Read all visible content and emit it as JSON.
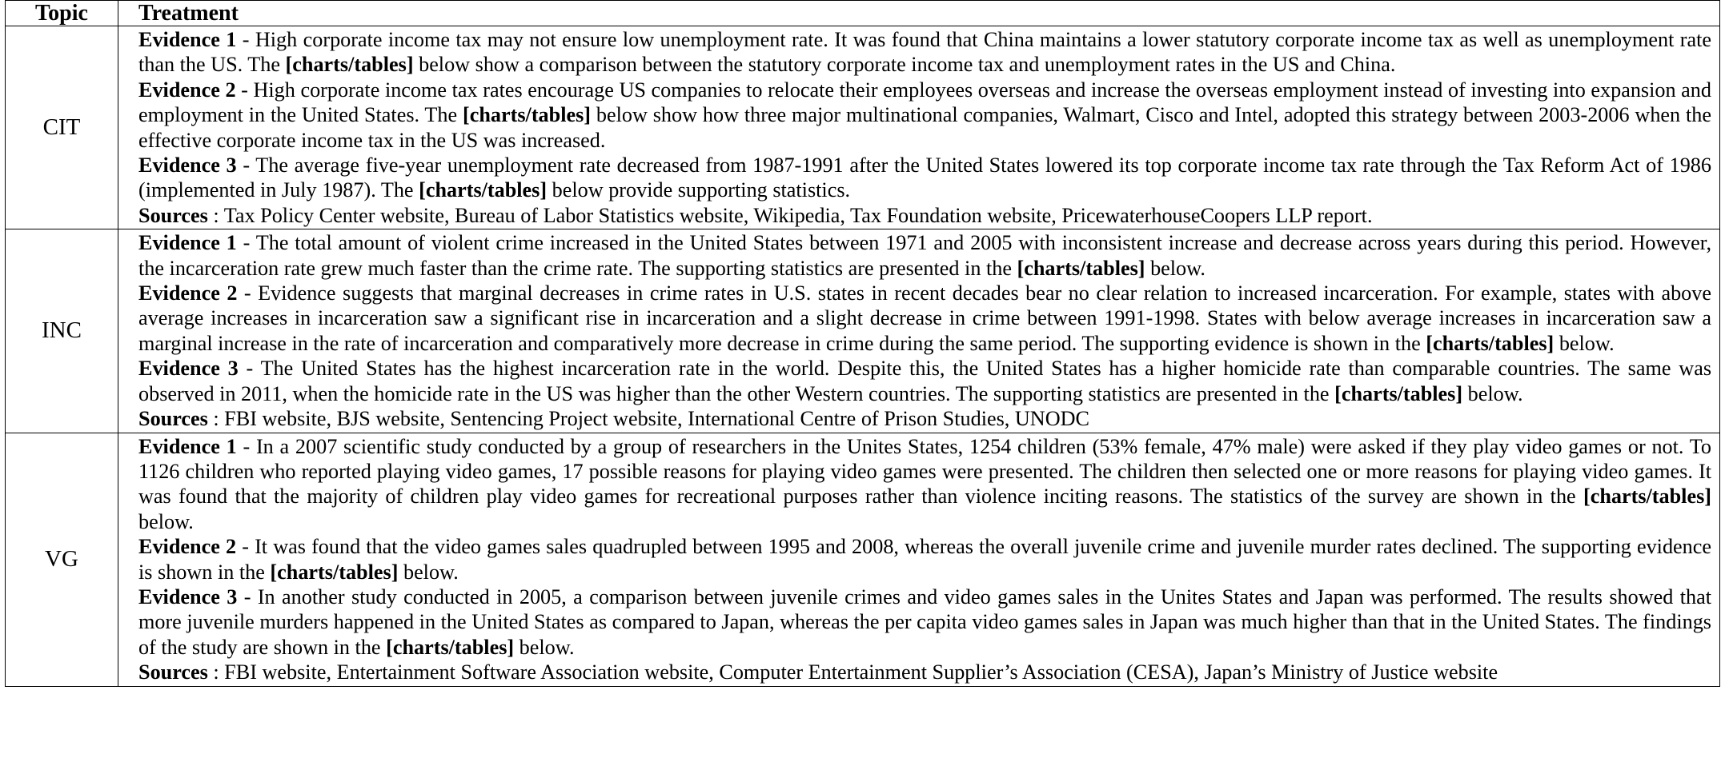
{
  "headers": {
    "topic": "Topic",
    "treatment": "Treatment"
  },
  "rows": [
    {
      "topic": "CIT",
      "evidence": [
        {
          "label": "Evidence 1",
          "pre": " - High corporate income tax may not ensure low unemployment rate.  It was found that China maintains a lower statutory corporate income tax as well as unemployment rate than the US. The ",
          "bold": "[charts/tables]",
          "post": " below show a comparison between the statutory corporate income tax and unemployment rates in the US and China."
        },
        {
          "label": "Evidence 2",
          "pre": " - High corporate income tax rates encourage US companies to relocate their employees overseas and increase the overseas employment instead of investing into expansion and employment in the United States. The ",
          "bold": "[charts/tables]",
          "post": " below show how three major multinational companies, Walmart, Cisco and Intel, adopted this strategy between 2003-2006 when the effective corporate income tax in the US was increased."
        },
        {
          "label": "Evidence 3",
          "pre": " - The average five-year unemployment rate decreased from 1987-1991 after the United States lowered its top corporate income tax rate through the Tax Reform Act of 1986 (implemented in July 1987). The ",
          "bold": "[charts/tables]",
          "post": " below provide supporting statistics."
        }
      ],
      "sources_label": "Sources",
      "sources": " : Tax Policy Center website, Bureau of Labor Statistics website, Wikipedia, Tax Foundation website, PricewaterhouseCoopers LLP report."
    },
    {
      "topic": "INC",
      "evidence": [
        {
          "label": "Evidence 1",
          "pre": " - The total amount of violent crime increased in the United States between 1971 and 2005 with inconsistent increase and decrease across years during this period. However, the incarceration rate grew much faster than the crime rate. The supporting statistics are presented in the ",
          "bold": "[charts/tables]",
          "post": " below."
        },
        {
          "label": "Evidence 2",
          "pre": " - Evidence suggests that marginal decreases in crime rates in U.S. states in recent decades bear no clear relation to increased incarceration. For example, states with above average increases in incarceration saw a significant rise in incarceration and a slight decrease in crime between 1991-1998. States with below average increases in incarceration saw a marginal increase in the rate of incarceration and comparatively more decrease in crime during the same period. The supporting evidence is shown in the ",
          "bold": "[charts/tables]",
          "post": " below."
        },
        {
          "label": "Evidence 3",
          "pre": " - The United States has the highest incarceration rate in the world. Despite this, the United States has a higher homicide rate than comparable countries. The same was observed in 2011, when the homicide rate in the US was higher than the other Western countries. The supporting statistics are presented in the ",
          "bold": "[charts/tables]",
          "post": " below."
        }
      ],
      "sources_label": "Sources",
      "sources": " : FBI website, BJS website, Sentencing Project website, International Centre of Prison Studies, UNODC"
    },
    {
      "topic": "VG",
      "evidence": [
        {
          "label": "Evidence 1",
          "pre": " - In a 2007 scientific study conducted by a group of researchers in the Unites States, 1254 children (53% female, 47% male) were asked if they play video games or not.  To 1126 children who reported playing video games, 17 possible reasons for playing video games were presented.  The children then selected one or more reasons for playing video games. It was found that the majority of children play video games for recreational purposes rather than violence inciting reasons. The statistics of the survey are shown in the ",
          "bold": "[charts/tables]",
          "post": " below."
        },
        {
          "label": "Evidence 2",
          "pre": " - It was found that the video games sales quadrupled between 1995 and 2008, whereas the overall juvenile crime and juvenile murder rates declined. The supporting evidence is shown in the ",
          "bold": "[charts/tables]",
          "post": " below."
        },
        {
          "label": "Evidence 3",
          "pre": " - In another study conducted in 2005, a comparison between juvenile crimes and video games sales in the Unites States and Japan was performed.  The results showed that more juvenile murders happened in the United States as compared to Japan, whereas the per capita video games sales in Japan was much higher than that in the United States. The findings of the study are shown in the ",
          "bold": "[charts/tables]",
          "post": " below."
        }
      ],
      "sources_label": "Sources",
      "sources": " : FBI website, Entertainment Software Association website, Computer Entertainment Supplier’s Association (CESA), Japan’s Ministry of Justice website"
    }
  ]
}
